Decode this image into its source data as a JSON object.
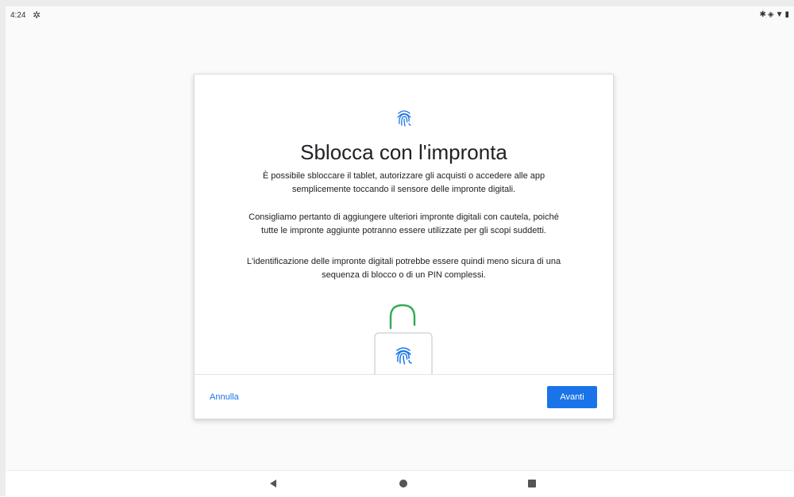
{
  "status_bar": {
    "time": "4:24",
    "settings_icon": "gear-icon",
    "right_icons": [
      "bluetooth-icon",
      "vibrate-icon",
      "wifi-icon",
      "battery-icon"
    ]
  },
  "dialog": {
    "top_icon": "fingerprint-icon",
    "title": "Sblocca con l'impronta",
    "paragraphs": [
      {
        "line1": "È possibile sbloccare il tablet, autorizzare gli acquisti o accedere alle app",
        "line2": "semplicemente toccando il sensore delle impronte digitali."
      },
      {
        "line1": "Consigliamo pertanto di aggiungere ulteriori impronte digitali con cautela, poiché",
        "line2": "tutte le impronte aggiunte potranno essere utilizzate per gli scopi suddetti."
      },
      {
        "line1": "L'identificazione delle impronte digitali potrebbe essere quindi meno sicura di una",
        "line2": "sequenza di blocco o di un PIN complessi."
      }
    ],
    "illustration": "padlock-fingerprint-icon",
    "cancel_label": "Annulla",
    "next_label": "Avanti"
  },
  "nav_bar": {
    "back_icon": "back-triangle-icon",
    "home_icon": "home-circle-icon",
    "recents_icon": "recents-square-icon"
  },
  "colors": {
    "accent": "#1a73e8",
    "lock_shackle": "#34a853",
    "text": "#202124"
  }
}
